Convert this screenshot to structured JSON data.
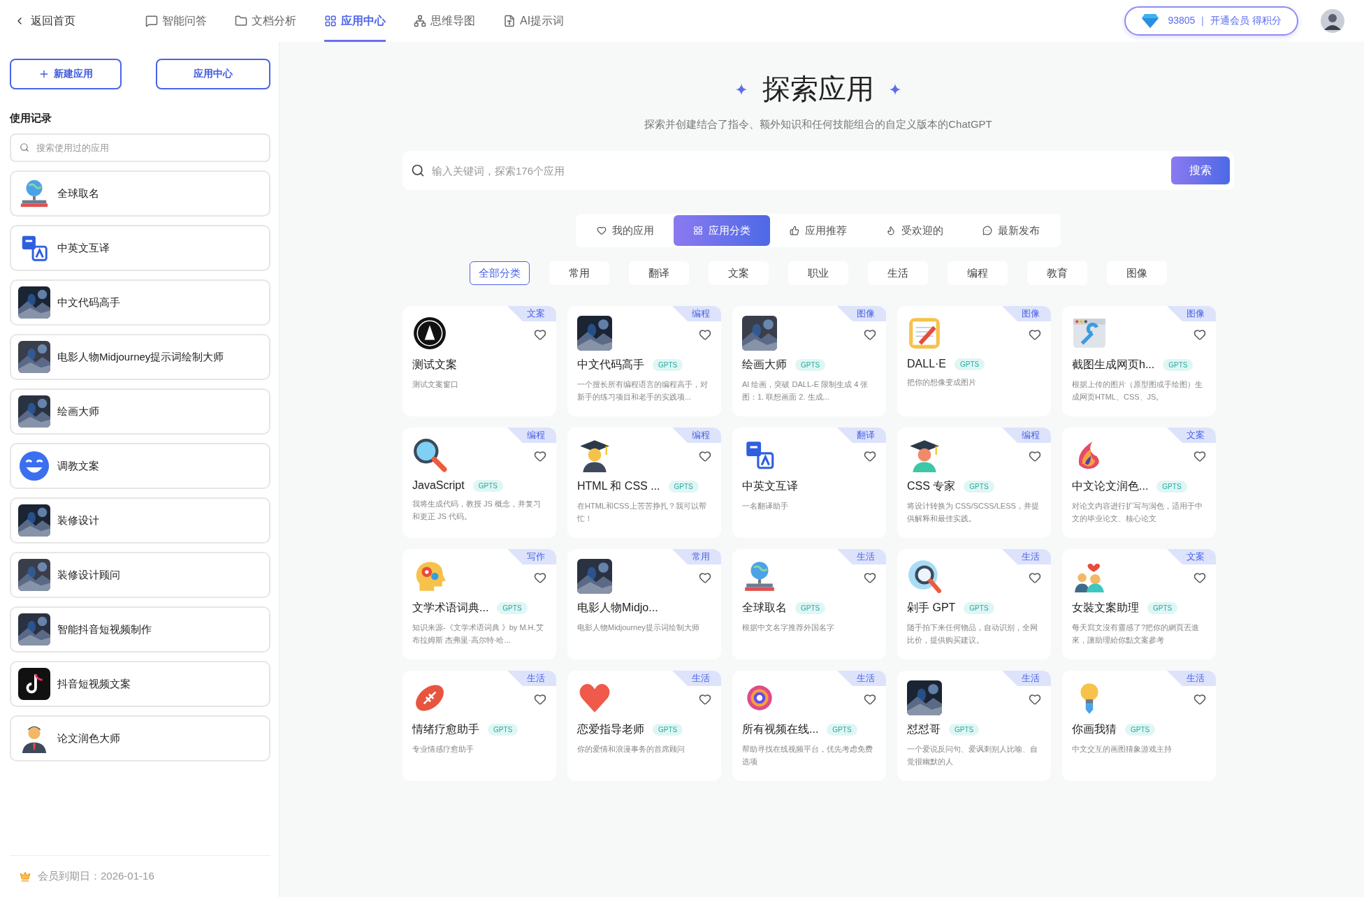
{
  "header": {
    "back": "返回首页",
    "nav": [
      {
        "label": "智能问答",
        "kind": "chat",
        "selected": false
      },
      {
        "label": "文档分析",
        "kind": "folder",
        "selected": false
      },
      {
        "label": "应用中心",
        "kind": "grid",
        "selected": true
      },
      {
        "label": "思维导图",
        "kind": "mindmap",
        "selected": false
      },
      {
        "label": "AI提示词",
        "kind": "prompt",
        "selected": false
      }
    ],
    "points": "93805 ｜ 开通会员 得积分"
  },
  "sidebar": {
    "new_app": "新建应用",
    "app_center": "应用中心",
    "history_title": "使用记录",
    "search": {
      "placeholder": "搜索使用过的应用"
    },
    "items": [
      {
        "name": "全球取名",
        "kind": "globe"
      },
      {
        "name": "中英文互译",
        "kind": "translate"
      },
      {
        "name": "中文代码高手",
        "kind": "picture"
      },
      {
        "name": "电影人物Midjourney提示词绘制大师",
        "kind": "picture"
      },
      {
        "name": "绘画大师",
        "kind": "picture"
      },
      {
        "name": "调教文案",
        "kind": "smiley"
      },
      {
        "name": "装修设计",
        "kind": "picture"
      },
      {
        "name": "装修设计顾问",
        "kind": "picture"
      },
      {
        "name": "智能抖音短视频制作",
        "kind": "picture"
      },
      {
        "name": "抖音短视频文案",
        "kind": "tiktok"
      },
      {
        "name": "论文润色大师",
        "kind": "person"
      }
    ],
    "footer": "会员到期日：2026-01-16"
  },
  "main": {
    "title": "探索应用",
    "subtitle": "探索并创建结合了指令、额外知识和任何技能组合的自定义版本的ChatGPT",
    "search": {
      "placeholder": "输入关键词，探索176个应用",
      "button": "搜索"
    },
    "tabs": [
      {
        "label": "我的应用",
        "kind": "heart",
        "selected": false
      },
      {
        "label": "应用分类",
        "kind": "grid",
        "selected": true
      },
      {
        "label": "应用推荐",
        "kind": "thumb",
        "selected": false
      },
      {
        "label": "受欢迎的",
        "kind": "flame",
        "selected": false
      },
      {
        "label": "最新发布",
        "kind": "message",
        "selected": false
      }
    ],
    "categories": [
      {
        "label": "全部分类",
        "selected": true
      },
      {
        "label": "常用",
        "selected": false
      },
      {
        "label": "翻译",
        "selected": false
      },
      {
        "label": "文案",
        "selected": false
      },
      {
        "label": "职业",
        "selected": false
      },
      {
        "label": "生活",
        "selected": false
      },
      {
        "label": "编程",
        "selected": false
      },
      {
        "label": "教育",
        "selected": false
      },
      {
        "label": "图像",
        "selected": false
      }
    ],
    "apps": [
      {
        "title": "测试文案",
        "desc": "测试文案窗口",
        "tag": "文案",
        "kind": "logo"
      },
      {
        "title": "中文代码高手",
        "badge": "GPTS",
        "desc": "一个擅长所有编程语言的编程高手，对新手的练习项目和老手的实践项...",
        "tag": "编程",
        "kind": "picture"
      },
      {
        "title": "绘画大师",
        "badge": "GPTS",
        "desc": "AI 绘画，突破 DALL-E 限制生成 4 张图：1. 联想画面 2. 生成...",
        "tag": "图像",
        "kind": "picture"
      },
      {
        "title": "DALL·E",
        "badge": "GPTS",
        "desc": "把你的想像变成图片",
        "tag": "图像",
        "kind": "notepad"
      },
      {
        "title": "截图生成网页h...",
        "badge": "GPTS",
        "desc": "根据上传的图片（原型图或手绘图）生成网页HTML、CSS、JS。",
        "tag": "图像",
        "kind": "wrench"
      },
      {
        "title": "JavaScript",
        "badge": "GPTS",
        "desc": "我将生成代码，教授 JS 概念，并复习和更正 JS 代码。",
        "tag": "编程",
        "kind": "magnifier"
      },
      {
        "title": "HTML 和 CSS ...",
        "badge": "GPTS",
        "desc": "在HTML和CSS上苦苦挣扎？我可以帮忙！",
        "tag": "编程",
        "kind": "graduate"
      },
      {
        "title": "中英文互译",
        "desc": "一名翻译助手",
        "tag": "翻译",
        "kind": "translate"
      },
      {
        "title": "CSS 专家",
        "badge": "GPTS",
        "desc": "将设计转换为 CSS/SCSS/LESS，并提供解释和最佳实践。",
        "tag": "编程",
        "kind": "graduate2"
      },
      {
        "title": "中文论文润色...",
        "badge": "GPTS",
        "desc": "对论文内容进行扩写与润色，适用于中文的毕业论文、核心论文",
        "tag": "文案",
        "kind": "flame"
      },
      {
        "title": "文学术语词典...",
        "badge": "GPTS",
        "desc": "知识来源-《文学术语词典 》by M.H.艾布拉姆斯 杰弗里·高尔特·哈...",
        "tag": "写作",
        "kind": "headgears"
      },
      {
        "title": "电影人物Midjo...",
        "desc": "电影人物Midjourney提示词绘制大师",
        "tag": "常用",
        "kind": "picture"
      },
      {
        "title": "全球取名",
        "badge": "GPTS",
        "desc": "根据中文名字推荐外国名字",
        "tag": "生活",
        "kind": "globe"
      },
      {
        "title": "剁手 GPT",
        "badge": "GPTS",
        "desc": "随手拍下来任何物品，自动识别，全网比价，提供购买建议。",
        "tag": "生活",
        "kind": "globelens"
      },
      {
        "title": "女裝文案助理",
        "badge": "GPTS",
        "desc": "每天寫文沒有靈感了?把你的網頁丟進來，讓助理給你點文案參考",
        "tag": "文案",
        "kind": "couple"
      },
      {
        "title": "情绪疗愈助手",
        "badge": "GPTS",
        "desc": "专业情感疗愈助手",
        "tag": "生活",
        "kind": "football"
      },
      {
        "title": "恋爱指导老师",
        "badge": "GPTS",
        "desc": "你的爱情和浪漫事务的首席顾问",
        "tag": "生活",
        "kind": "heart"
      },
      {
        "title": "所有视频在线...",
        "badge": "GPTS",
        "desc": "帮助寻找在线视频平台，优先考虑免费选项",
        "tag": "生活",
        "kind": "film"
      },
      {
        "title": "怼怼哥",
        "badge": "GPTS",
        "desc": "一个爱说反问句、爱讽刺别人比喻、自觉很幽默的人",
        "tag": "生活",
        "kind": "picture"
      },
      {
        "title": "你画我猜",
        "badge": "GPTS",
        "desc": "中文交互的画图猜象游戏主持",
        "tag": "生活",
        "kind": "bulb"
      }
    ]
  }
}
